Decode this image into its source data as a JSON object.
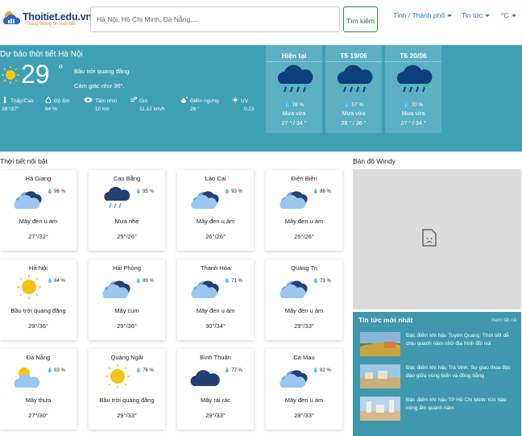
{
  "header": {
    "logo_name": "Thoitiet.edu.vn",
    "logo_tagline": "Trang thông tin thời tiết",
    "search_placeholder": "Hà Nội, Hồ Chí Minh, Đà Nẵng,...",
    "search_button": "Tìm kiếm",
    "nav": [
      {
        "label": "Tỉnh / Thành phố"
      },
      {
        "label": "Tin tức"
      },
      {
        "label": "°C"
      }
    ]
  },
  "current": {
    "title": "Dự báo thời tiết Hà Nội",
    "temp": "29",
    "deg": "°",
    "condition": "Bầu trời quang đãng",
    "feels_like": "Cảm giác như 36°.",
    "stats": [
      {
        "label": "Thấp/Cao",
        "value": "28°/37°",
        "icon": "thermometer-icon"
      },
      {
        "label": "Độ ẩm",
        "value": "84 %",
        "icon": "humidity-icon"
      },
      {
        "label": "Tầm nhìn",
        "value": "10 km",
        "icon": "eye-icon"
      },
      {
        "label": "Gió",
        "value": "11.12 km/h",
        "icon": "wind-icon"
      },
      {
        "label": "Điểm ngưng",
        "value": "26 °",
        "icon": "dewpoint-icon"
      },
      {
        "label": "UV",
        "value": "0.23",
        "icon": "uv-icon"
      }
    ]
  },
  "forecast": [
    {
      "title": "Hiện tại",
      "pct": "78 %",
      "condition": "Mưa vừa",
      "range": "27 ° / 34 °"
    },
    {
      "title": "T5 19/06",
      "pct": "57 %",
      "condition": "Mưa vừa",
      "range": "28 ° / 36 °"
    },
    {
      "title": "T6 20/06",
      "pct": "70 %",
      "condition": "Mưa vừa",
      "range": "27 ° / 34 °"
    }
  ],
  "highlight_title": "Thời tiết nổi bật",
  "map_title": "Bản đồ Windy",
  "cities": [
    {
      "name": "Hà Giang",
      "pct": "96 %",
      "condition": "Mây đen u ám",
      "range": "27°/32°",
      "icon": "overcast"
    },
    {
      "name": "Cao Bằng",
      "pct": "95 %",
      "condition": "Mưa nhẹ",
      "range": "25°/26°",
      "icon": "rain"
    },
    {
      "name": "Lào Cai",
      "pct": "93 %",
      "condition": "Mây đen u ám",
      "range": "26°/26°",
      "icon": "overcast"
    },
    {
      "name": "Điện Biên",
      "pct": "86 %",
      "condition": "Mây đen u ám",
      "range": "25°/26°",
      "icon": "overcast"
    },
    {
      "name": "Hà Nội",
      "pct": "84 %",
      "condition": "Bầu trời quang đãng",
      "range": "29°/36°",
      "icon": "sun"
    },
    {
      "name": "Hải Phòng",
      "pct": "89 %",
      "condition": "Mây cụm",
      "range": "29°/36°",
      "icon": "overcast"
    },
    {
      "name": "Thanh Hóa",
      "pct": "71 %",
      "condition": "Mây đen u ám",
      "range": "30°/34°",
      "icon": "overcast"
    },
    {
      "name": "Quảng Trị",
      "pct": "73 %",
      "condition": "Mây đen u ám",
      "range": "29°/33°",
      "icon": "overcast"
    },
    {
      "name": "Đà Nẵng",
      "pct": "83 %",
      "condition": "Mây thưa",
      "range": "27°/30°",
      "icon": "suncloud"
    },
    {
      "name": "Quảng Ngãi",
      "pct": "76 %",
      "condition": "Bầu trời quang đãng",
      "range": "29°/33°",
      "icon": "sun"
    },
    {
      "name": "Bình Thuận",
      "pct": "77 %",
      "condition": "Mây rải rác",
      "range": "29°/33°",
      "icon": "darkcloud"
    },
    {
      "name": "Cà Mau",
      "pct": "82 %",
      "condition": "Mây đen u ám",
      "range": "28°/33°",
      "icon": "overcast"
    }
  ],
  "news": {
    "title": "Tin tức mới nhất",
    "see_all": "Xem tất cả",
    "items": [
      {
        "title": "Đặc điểm khí hậu Tuyên Quang: Thời tiết dễ chịu quanh năm nhờ địa hình đồi núi"
      },
      {
        "title": "Đặc điểm khí hậu Trà Vinh: Sự giao thoa độc đáo giữa vùng biển và đồng bằng"
      },
      {
        "title": "Đặc điểm khí hậu TP Hồ Chí Minh: Khí hậu nóng ẩm quanh năm"
      }
    ]
  },
  "colors": {
    "hero": "#3fa0b4",
    "card": "#5bb0c2",
    "news": "#3f98ad",
    "brand": "#1a3a8a",
    "accent": "#e8891e",
    "link": "#1a73c8"
  }
}
